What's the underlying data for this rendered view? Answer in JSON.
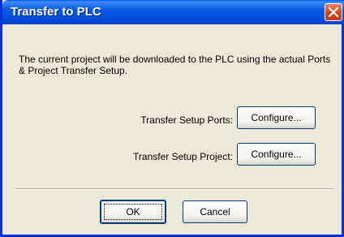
{
  "window": {
    "title": "Transfer to PLC",
    "close_icon": "close-x-icon"
  },
  "message": "The current project will be downloaded to the PLC using the actual Ports & Project Transfer Setup.",
  "rows": [
    {
      "label": "Transfer Setup Ports:",
      "button": "Configure..."
    },
    {
      "label": "Transfer Setup Project:",
      "button": "Configure..."
    }
  ],
  "buttons": {
    "ok": "OK",
    "cancel": "Cancel"
  },
  "colors": {
    "titlebar": "#0a5ae0",
    "close_button": "#d2461f",
    "dialog_background": "#ece9d8"
  }
}
